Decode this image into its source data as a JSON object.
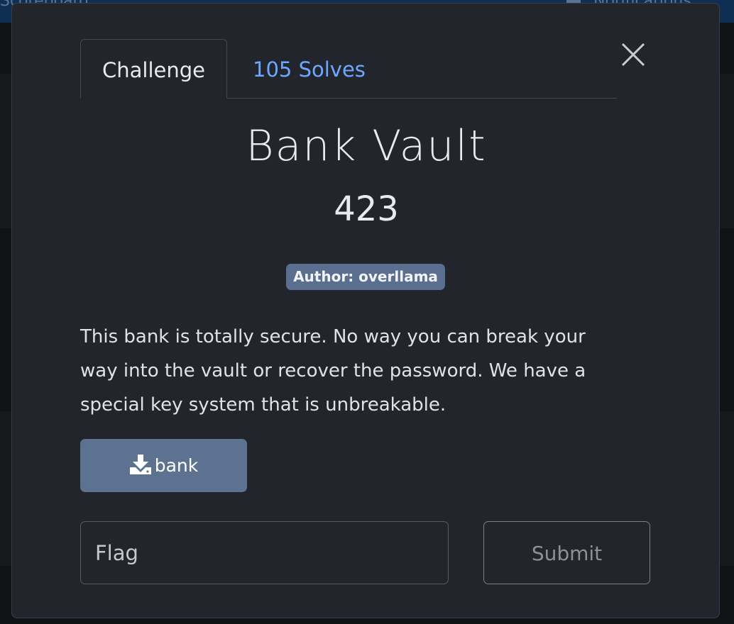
{
  "background": {
    "nav_left": "Scoreboard",
    "nav_right": "Notifications"
  },
  "modal": {
    "tabs": [
      {
        "label": "Challenge",
        "active": true
      },
      {
        "label": "105 Solves",
        "active": false
      }
    ],
    "title": "Bank Vault",
    "points": "423",
    "author_badge": "Author: overllama",
    "description": "This bank is totally secure. No way you can break your way into the vault or recover the password. We have a special key system that is unbreakable.",
    "download_label": "bank",
    "flag_placeholder": "Flag",
    "submit_label": "Submit",
    "icons": {
      "close": "close-icon",
      "download": "download-icon"
    }
  }
}
